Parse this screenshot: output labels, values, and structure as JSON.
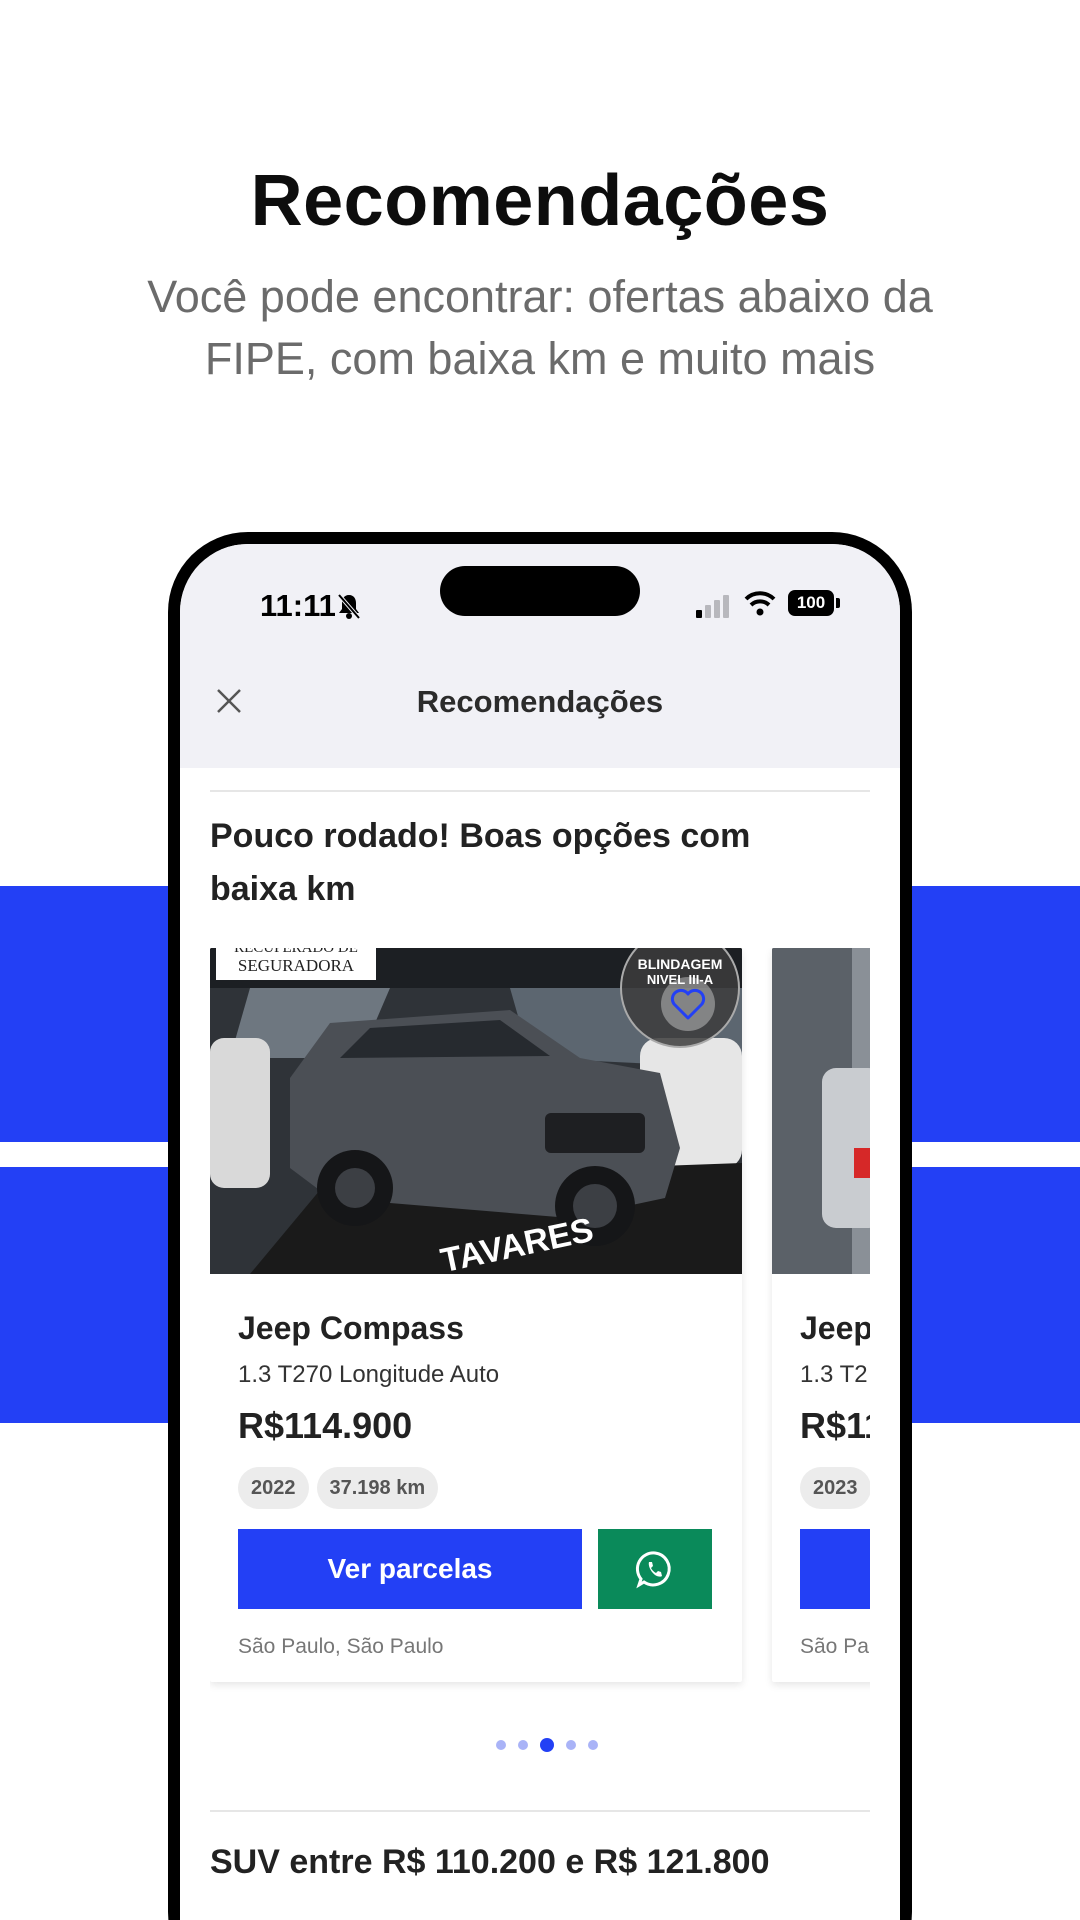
{
  "promo": {
    "title": "Recomendações",
    "subtitle": "Você pode encontrar: ofertas abaixo da FIPE, com baixa km e muito mais"
  },
  "status_bar": {
    "time": "11:11",
    "battery": "100"
  },
  "nav": {
    "title": "Recomendações"
  },
  "sections": [
    {
      "title": "Pouco rodado! Boas opções com baixa km"
    },
    {
      "title": "SUV entre R$ 110.200 e R$ 121.800"
    }
  ],
  "cards": [
    {
      "photo_caption_top": "RECUPERADO DE",
      "photo_caption": "SEGURADORA",
      "photo_badge_line1": "BLINDAGEM",
      "photo_badge_line2": "NIVEL III-A",
      "photo_mat_text": "TAVARES",
      "title": "Jeep Compass",
      "version": "1.3 T270 Longitude Auto",
      "price": "R$114.900",
      "year": "2022",
      "km": "37.198 km",
      "cta": "Ver parcelas",
      "location": "São Paulo, São Paulo"
    },
    {
      "title": "Jeep",
      "version": "1.3 T2",
      "price": "R$11",
      "year": "2023",
      "location": "São Pa"
    }
  ],
  "pager": {
    "count": 5,
    "active_index": 2
  },
  "colors": {
    "brand_blue": "#2340f5",
    "whatsapp_green": "#0a8a5a",
    "pager_inactive": "#a9b3f7"
  },
  "icons": {
    "close": "close-icon",
    "favorite": "heart-icon",
    "whatsapp": "whatsapp-icon",
    "bell_muted": "bell-slash-icon",
    "signal": "signal-icon",
    "wifi": "wifi-icon"
  }
}
